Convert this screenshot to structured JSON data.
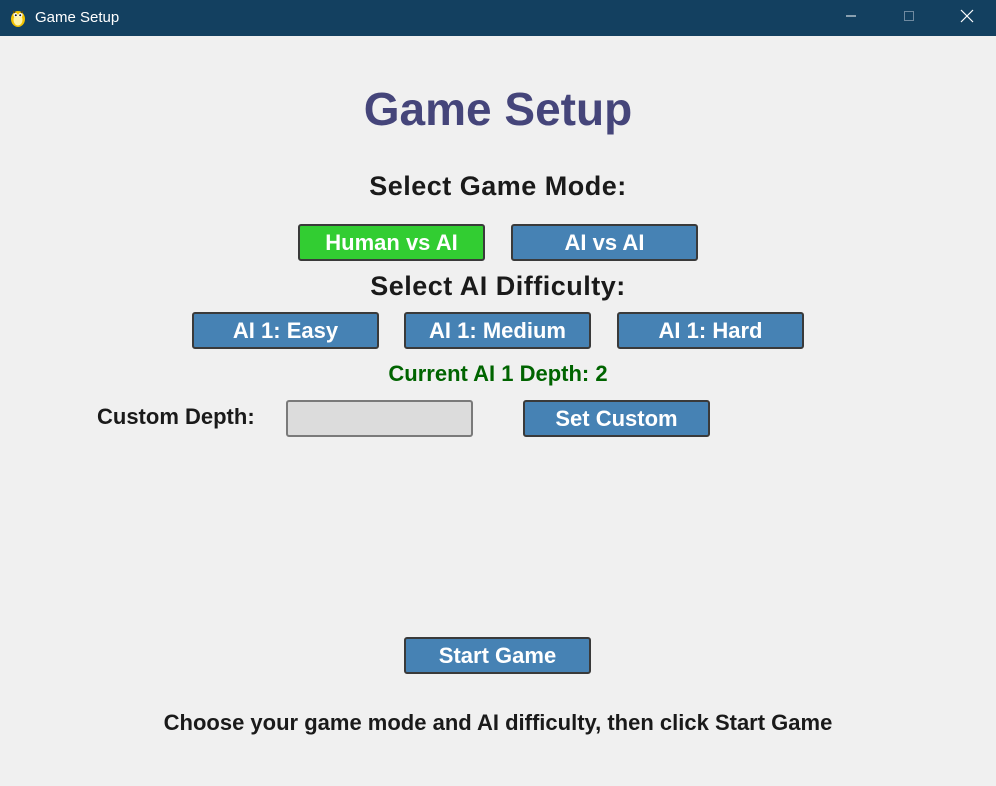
{
  "window": {
    "title": "Game Setup",
    "titlebar_color": "#134060"
  },
  "setup": {
    "title": "Game Setup",
    "mode_heading": "Select Game Mode:",
    "modes": [
      {
        "label": "Human vs AI",
        "selected": true
      },
      {
        "label": "AI vs AI",
        "selected": false
      }
    ],
    "difficulty_heading": "Select AI Difficulty:",
    "difficulties": [
      {
        "label": "AI 1: Easy"
      },
      {
        "label": "AI 1: Medium"
      },
      {
        "label": "AI 1: Hard"
      }
    ],
    "depth_status": "Current AI 1 Depth: 2",
    "custom_label": "Custom Depth:",
    "custom_value": "",
    "custom_placeholder": "",
    "set_custom_label": "Set Custom",
    "start_label": "Start Game",
    "instructions": "Choose your game mode and AI difficulty, then click Start Game"
  },
  "colors": {
    "button": "#4682b4",
    "selected_button": "#32cd32",
    "title": "#45457a",
    "status": "#006400",
    "background": "#f0f0f0"
  },
  "icons": {
    "app": "pygame-snake-icon",
    "minimize": "minimize-icon",
    "maximize": "maximize-icon",
    "close": "close-icon"
  }
}
